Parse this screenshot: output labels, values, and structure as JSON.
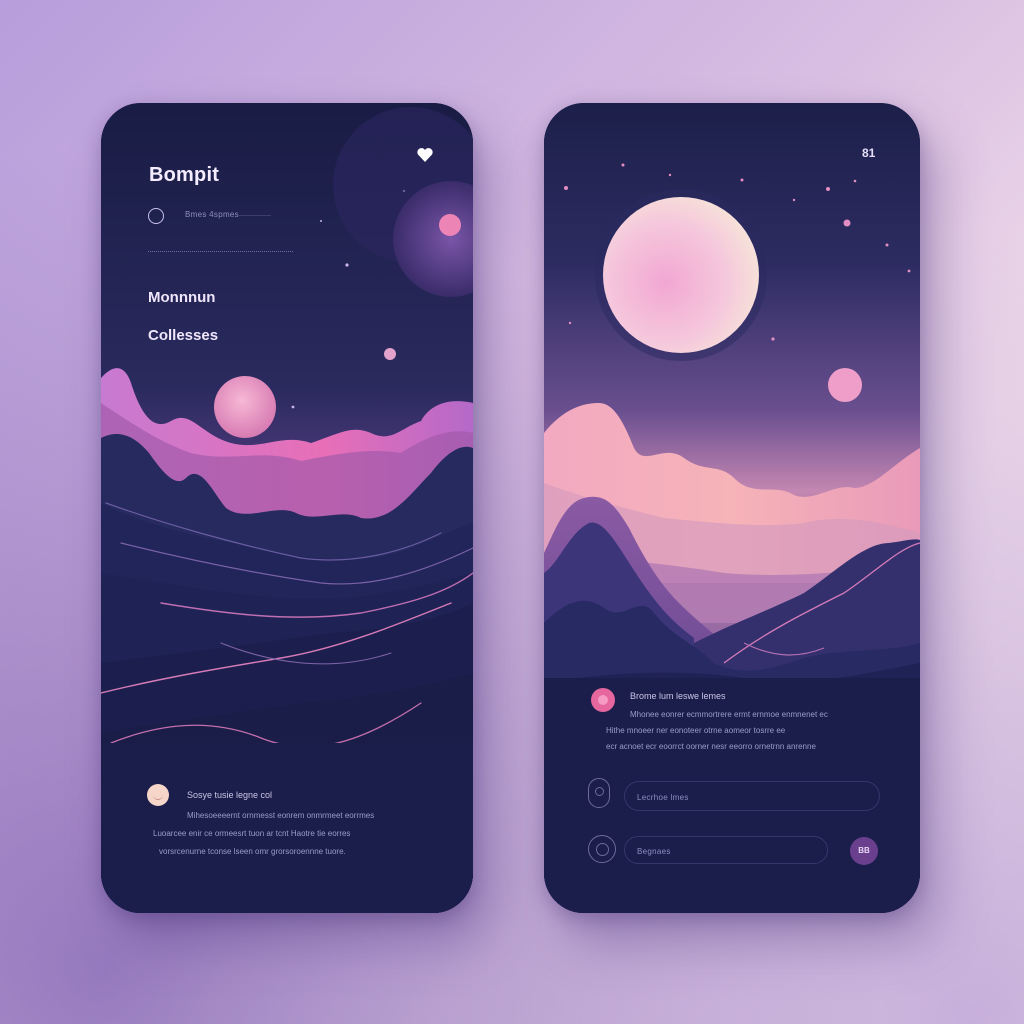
{
  "left_screen": {
    "title": "Bompit",
    "subtitle": "Bmes 4spmes",
    "nav_items": [
      {
        "label": "Monnnun"
      },
      {
        "label": "Collesses"
      }
    ],
    "heart_icon": "heart-icon",
    "footer": {
      "heading": "Sosye tusie legne col",
      "lines": [
        "Mihesoeeeernt ornmesst eonrem  onmrmeet eorrmes",
        "Luoarcee enir ce ormeesrt  tuon ar tcnt  Haotre tie eorres",
        "vorsrcenurne tconse lseen omr  grorsoroennne tuore."
      ]
    }
  },
  "right_screen": {
    "page_number": "81",
    "info": {
      "heading": "Brome lum leswe lemes",
      "lines": [
        "Mhonee eonrer ecmmortrere ermt ernmoe enmnenet ec",
        "Hithe  mnoeer ner eonoteer otrne aomeor tosrre ee",
        "ecr acnoet ecr eoorrct oorner nesr eeorro ornetrnn anrenne"
      ]
    },
    "search_field": {
      "label": "Lecrhoe lmes",
      "icon": "location-pin-icon"
    },
    "second_field": {
      "label": "Begnaes",
      "icon": "circle-icon"
    },
    "go_button": {
      "label": "BB"
    }
  },
  "colors": {
    "phone_bg": "#1a1d45",
    "accent_pink": "#ec6fa8",
    "moon": "#f3c2dc",
    "mountain_dark": "#1e2050"
  }
}
